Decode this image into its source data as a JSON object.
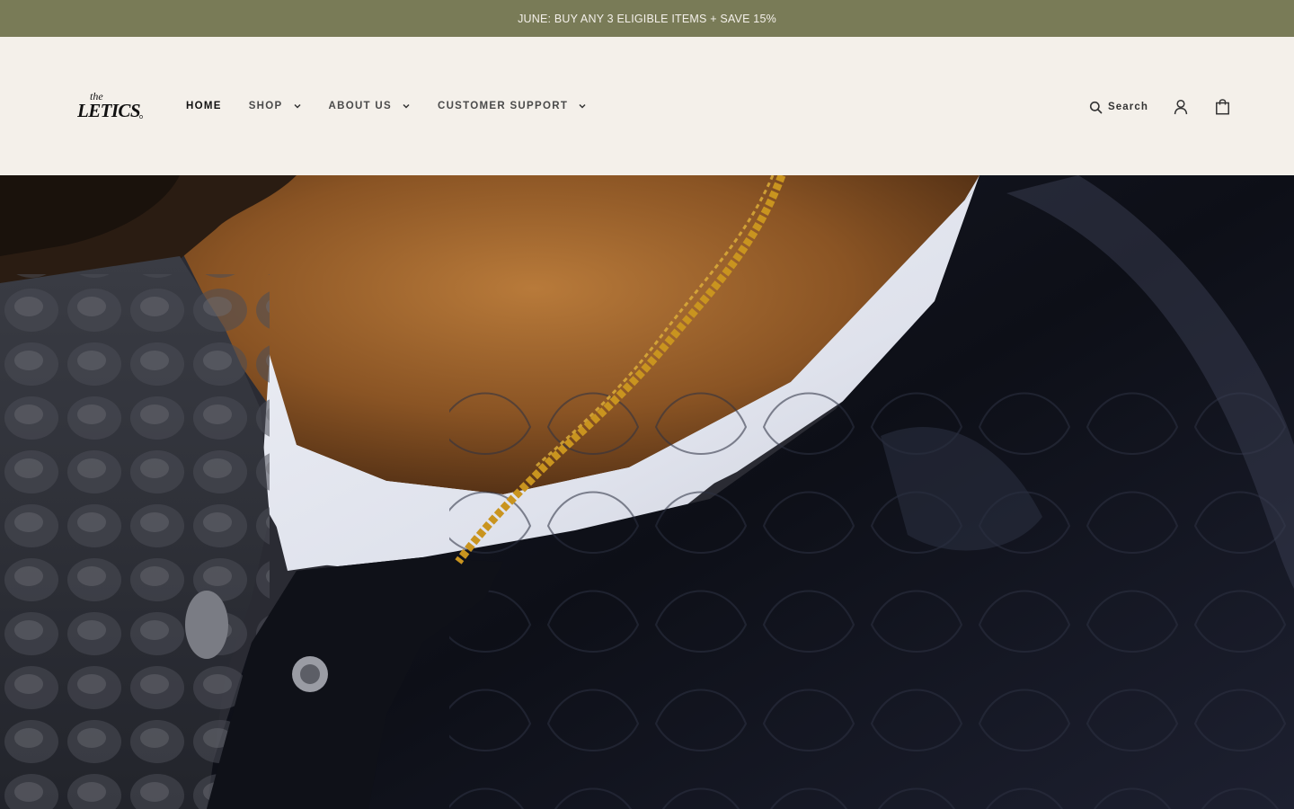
{
  "announcement": {
    "text": "JUNE: BUY ANY 3 ELIGIBLE ITEMS + SAVE 15%"
  },
  "header": {
    "logo": {
      "small_text": "the",
      "main_text": "LETICS",
      "icon": "the-letics-logo"
    },
    "nav": [
      {
        "label": "HOME",
        "active": true,
        "has_dropdown": false
      },
      {
        "label": "SHOP",
        "active": false,
        "has_dropdown": true
      },
      {
        "label": "ABOUT US",
        "active": false,
        "has_dropdown": true
      },
      {
        "label": "CUSTOMER SUPPORT",
        "active": false,
        "has_dropdown": true
      }
    ],
    "search": {
      "label": "Search",
      "icon": "search-icon"
    },
    "account": {
      "icon": "account-icon"
    },
    "cart": {
      "icon": "shopping-bag-icon"
    }
  },
  "hero": {
    "image": "close-up of person wearing black quilted jacket, white crew neck and gold chain"
  },
  "colors": {
    "announcement_bg": "#797b57",
    "announcement_text": "#f4f0ea",
    "header_bg": "#f4f0ea",
    "nav_text": "#4a4a4a",
    "nav_active": "#111111"
  }
}
